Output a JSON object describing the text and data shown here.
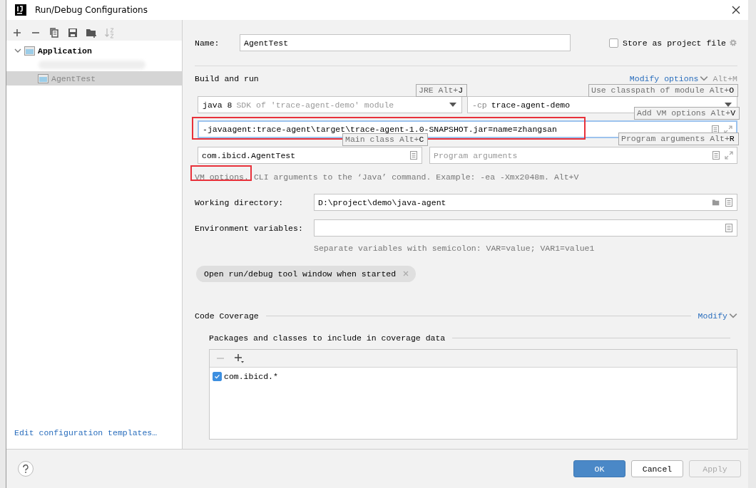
{
  "window": {
    "title": "Run/Debug Configurations"
  },
  "sidebar": {
    "tree": [
      {
        "label": "Application",
        "expanded": true,
        "selected": false,
        "children": [
          {
            "label": "AgentTest",
            "selected": true
          }
        ]
      }
    ],
    "link": "Edit configuration templates…"
  },
  "form": {
    "name_label": "Name:",
    "name_value": "AgentTest",
    "store_as_project_file": {
      "label": "Store as project file",
      "checked": false
    },
    "section_title": "Build and run",
    "modify_options": {
      "label": "Modify options",
      "shortcut": "Alt+M"
    },
    "jre": {
      "value": "java 8",
      "hint": "SDK of 'trace-agent-demo' module"
    },
    "classpath": {
      "prefix": "-cp",
      "value": "trace-agent-demo"
    },
    "vm_options": {
      "value": "-javaagent:trace-agent\\target\\trace-agent-1.0-SNAPSHOT.jar=name=zhangsan",
      "focused": true,
      "highlighted": true
    },
    "main_class": {
      "value": "com.ibicd.AgentTest"
    },
    "program_arguments": {
      "placeholder": "Program arguments"
    },
    "vm_hint": {
      "label": "VM options.",
      "text": "CLI arguments to the ‘Java’ command. Example: -ea -Xmx2048m. Alt+V",
      "highlighted": true
    },
    "working_directory": {
      "label": "Working directory:",
      "value": "D:\\project\\demo\\java-agent"
    },
    "environment_variables": {
      "label": "Environment variables:",
      "hint": "Separate variables with semicolon: VAR=value; VAR1=value1"
    },
    "chips": [
      {
        "label": "Open run/debug tool window when started"
      }
    ],
    "tooltips": [
      {
        "text": "JRE Alt+**J**"
      },
      {
        "text": "Use classpath of module Alt+**O**"
      },
      {
        "text": "Add VM options Alt+**V**"
      },
      {
        "text": "Main class Alt+**C**"
      },
      {
        "text": "Program arguments Alt+**R**"
      }
    ]
  },
  "code_coverage": {
    "title": "Code Coverage",
    "modify": "Modify",
    "packages_title": "Packages and classes to include in coverage data",
    "entries": [
      {
        "label": "com.ibicd.*",
        "checked": true
      }
    ]
  },
  "buttons": [
    {
      "label": "OK",
      "kind": "primary",
      "disabled": false
    },
    {
      "label": "Cancel",
      "kind": "normal",
      "disabled": false
    },
    {
      "label": "Apply",
      "kind": "normal",
      "disabled": true
    }
  ]
}
